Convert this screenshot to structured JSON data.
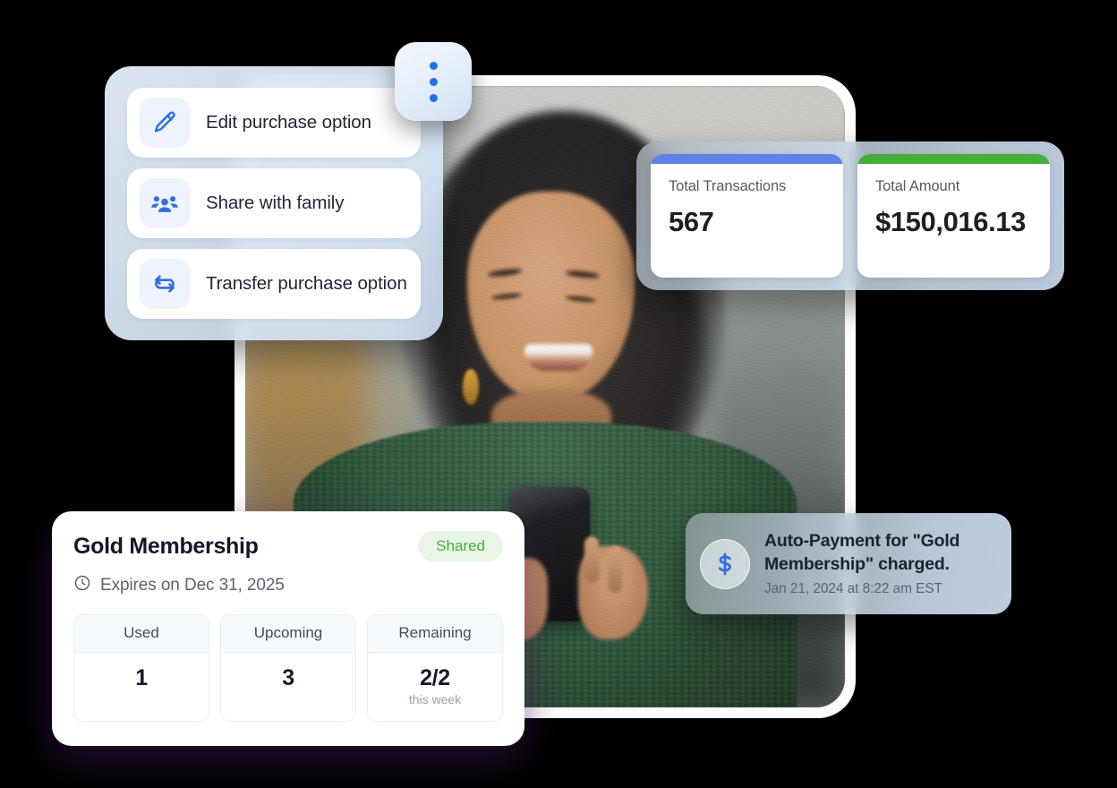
{
  "kebab_menu_button": {
    "name": "more-options",
    "dots": 3
  },
  "menu_panel": {
    "items": [
      {
        "icon": "pencil-icon",
        "label": "Edit purchase option"
      },
      {
        "icon": "people-group-icon",
        "label": "Share with family"
      },
      {
        "icon": "transfer-arrows-icon",
        "label": "Transfer purchase option"
      }
    ]
  },
  "stats_panel": {
    "cards": [
      {
        "label": "Total Transactions",
        "value": "567",
        "accent": "#6081E6"
      },
      {
        "label": "Total Amount",
        "value": "$150,016.13",
        "accent": "#46AE38"
      }
    ]
  },
  "membership_card": {
    "title": "Gold Membership",
    "badge": "Shared",
    "badge_color": "#41b03a",
    "expiry": "Expires on Dec 31, 2025",
    "expiry_icon": "clock-icon",
    "stats": [
      {
        "header": "Used",
        "value": "1",
        "sub": ""
      },
      {
        "header": "Upcoming",
        "value": "3",
        "sub": ""
      },
      {
        "header": "Remaining",
        "value": "2/2",
        "sub": "this week"
      }
    ]
  },
  "toast": {
    "icon": "dollar-circle-icon",
    "title": "Auto-Payment for \"Gold Membership\" charged.",
    "time": "Jan 21, 2024 at 8:22 am EST"
  },
  "photo": {
    "alt": "Smiling woman in green sweater looking at her phone on a city street"
  }
}
